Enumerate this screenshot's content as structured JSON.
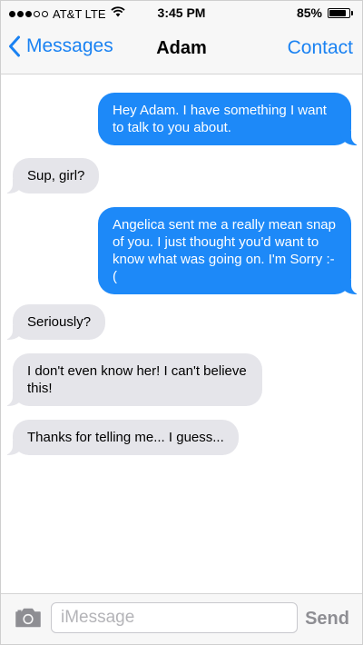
{
  "status_bar": {
    "carrier": "AT&T LTE",
    "time": "3:45 PM",
    "battery_percent": "85%",
    "battery_level": 0.85
  },
  "nav": {
    "back_label": "Messages",
    "title": "Adam",
    "right_label": "Contact"
  },
  "messages": [
    {
      "direction": "out",
      "text": "Hey Adam.  I have something I want to talk to you about."
    },
    {
      "direction": "in",
      "text": "Sup, girl?"
    },
    {
      "direction": "out",
      "text": "Angelica sent me a really mean snap of you. I just thought you'd want to know what was going on. I'm Sorry :-("
    },
    {
      "direction": "in",
      "text": "Seriously?"
    },
    {
      "direction": "in",
      "text": "I don't even know her! I can't believe this!"
    },
    {
      "direction": "in",
      "text": "Thanks for telling me... I guess..."
    }
  ],
  "input_bar": {
    "placeholder": "iMessage",
    "send_label": "Send"
  },
  "colors": {
    "accent": "#1a82f2",
    "outgoing_bubble": "#1d89f8",
    "incoming_bubble": "#e5e5ea"
  },
  "icons": {
    "back": "chevron-left-icon",
    "camera": "camera-icon",
    "wifi": "wifi-icon",
    "battery": "battery-icon"
  }
}
